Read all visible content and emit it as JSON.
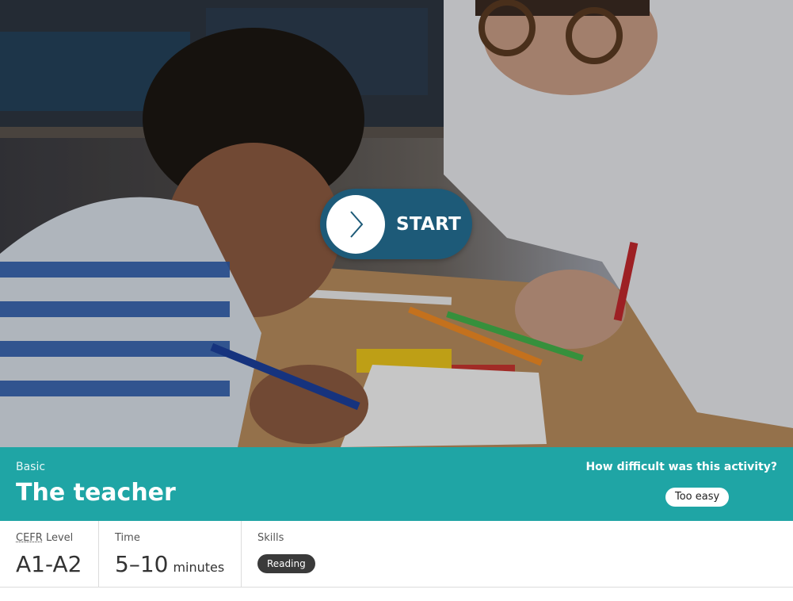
{
  "hero": {
    "image_alt": "Child drawing with markers at a table while a teacher watches",
    "start_label": "START"
  },
  "activity": {
    "level": "Basic",
    "title": "The teacher"
  },
  "feedback": {
    "question": "How difficult was this activity?",
    "selected_option": "Too easy"
  },
  "stats": {
    "cefr_abbr": "CEFR",
    "cefr_label_rest": " Level",
    "cefr_value": "A1-A2",
    "time_label": "Time",
    "time_value": "5–10",
    "time_unit": "minutes",
    "skills_label": "Skills",
    "skills": [
      "Reading"
    ]
  },
  "colors": {
    "accent": "#1fa5a5",
    "start_button": "#1d5a78",
    "pill_dark": "#3a3a3a"
  }
}
